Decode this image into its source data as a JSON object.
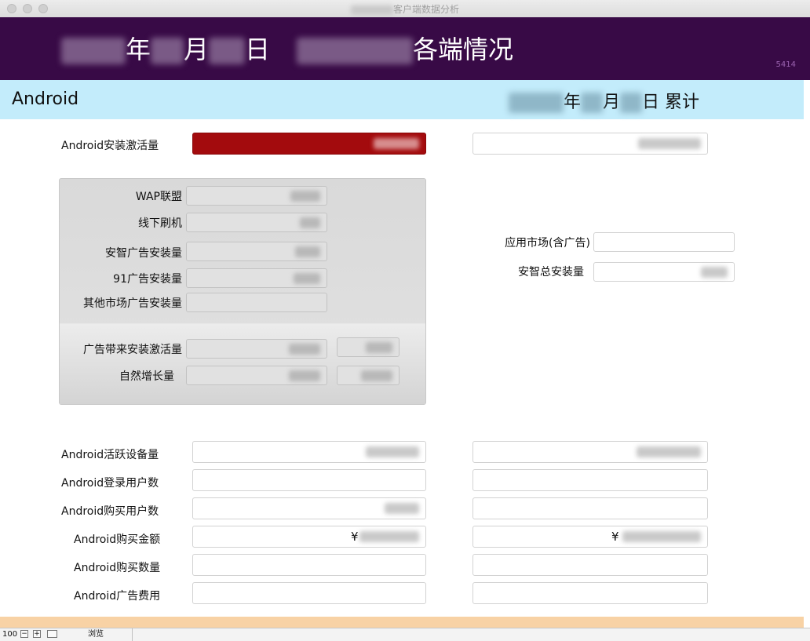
{
  "window": {
    "title": "客户端数据分析"
  },
  "header": {
    "year_suffix": "年",
    "month_suffix": "月",
    "day_suffix": "日",
    "title_suffix": "各端情况",
    "counter": "5414"
  },
  "section": {
    "title": "Android",
    "cum_year": "年",
    "cum_month": "月",
    "cum_day": "日 累计"
  },
  "rows": {
    "install_activation": "Android安装激活量",
    "active_devices": "Android活跃设备量",
    "login_users": "Android登录用户数",
    "buy_users": "Android购买用户数",
    "buy_amount": "Android购买金额",
    "buy_qty": "Android购买数量",
    "ad_cost": "Android广告费用"
  },
  "panel": {
    "wap": "WAP联盟",
    "offline": "线下刷机",
    "anzhi_ad": "安智广告安装量",
    "ad91": "91广告安装量",
    "other_market": "其他市场广告安装量",
    "ad_activation": "广告带来安装激活量",
    "natural_growth": "自然增长量"
  },
  "right_panel": {
    "app_market": "应用市场(含广告)",
    "anzhi_total": "安智总安装量"
  },
  "currency": "¥",
  "statusbar": {
    "zoom": "100",
    "mode": "浏览"
  }
}
